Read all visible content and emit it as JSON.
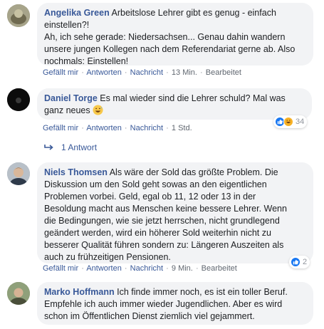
{
  "comments": [
    {
      "author": "Angelika Green",
      "text": "Arbeitslose Lehrer gibt es genug - einfach einstellen?!\nAh, ich sehe gerade: Niedersachsen... Genau dahin wandern unsere jungen Kollegen nach dem Referendariat gerne ab. Also nochmals: Einstellen!",
      "line1": "Arbeitslose Lehrer gibt es genug - einfach",
      "line2": "einstellen?!",
      "line3": "Ah, ich sehe gerade: Niedersachsen... Genau dahin wandern",
      "line4": "unsere jungen Kollegen nach dem Referendariat gerne ab. Also",
      "line5": "nochmals: Einstellen!",
      "like": "Gefällt mir",
      "reply": "Antworten",
      "message": "Nachricht",
      "time": "13 Min.",
      "edited": "Bearbeitet"
    },
    {
      "author": "Daniel Torge",
      "line1": "Es mal wieder sind die Lehrer schuld? Mal was",
      "line2": "ganz neues",
      "emoji": "grinning-sweat-emoji",
      "like": "Gefällt mir",
      "reply": "Antworten",
      "message": "Nachricht",
      "time": "1 Std.",
      "reaction_count": "34",
      "reactions": [
        "like",
        "haha"
      ],
      "replies": "1 Antwort"
    },
    {
      "author": "Niels Thomsen",
      "line1": "Als wäre der Sold das größte Problem. Die",
      "line2": "Diskussion um den Sold geht sowas an den eigentlichen",
      "line3": "Problemen vorbei. Geld, egal ob 11, 12 oder 13 in der",
      "line4": "Besoldung macht aus Menschen keine bessere Lehrer. Wenn",
      "line5": "die Bedingungen, wie sie jetzt herrschen, nicht grundlegend",
      "line6": "geändert werden, wird ein höherer Sold weiterhin nicht zu",
      "line7": "besserer Qualität führen sondern zu: Längeren Auszeiten als",
      "line8": "auch zu frühzeitigen Pensionen.",
      "like": "Gefällt mir",
      "reply": "Antworten",
      "message": "Nachricht",
      "time": "9 Min.",
      "edited": "Bearbeitet",
      "reaction_count": "2",
      "reactions": [
        "like"
      ]
    },
    {
      "author": "Marko Hoffmann",
      "line1": "Ich finde immer noch, es ist ein toller Beruf.",
      "line2": "Empfehle ich auch immer wieder Jugendlichen. Aber es wird",
      "line3": "schon im Öffentlichen Dienst ziemlich viel gejammert."
    }
  ],
  "colors": {
    "name": "#385898",
    "bubble": "#f2f3f5",
    "meta": "#606770",
    "like_blue": "#1877f2"
  },
  "separator": "·"
}
